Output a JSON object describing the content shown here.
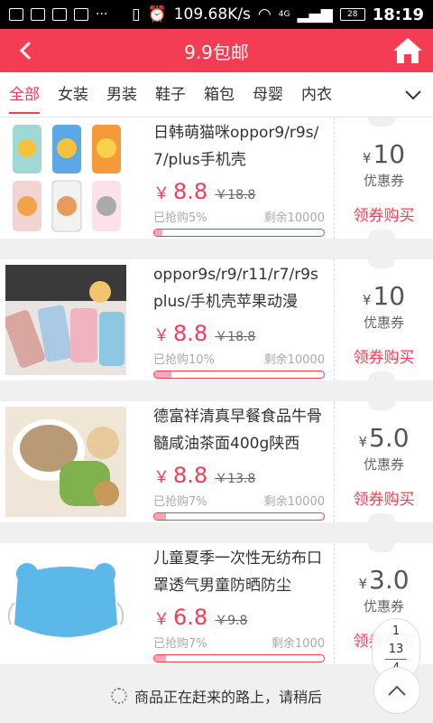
{
  "status_bar": {
    "network_speed": "109.68K/s",
    "signal": "4G",
    "battery": "28",
    "time": "18:19"
  },
  "header": {
    "title": "9.9包邮",
    "back_icon": "chevron-left-icon",
    "home_icon": "home-icon"
  },
  "tabs": [
    {
      "label": "全部",
      "active": true
    },
    {
      "label": "女装",
      "active": false
    },
    {
      "label": "男装",
      "active": false
    },
    {
      "label": "鞋子",
      "active": false
    },
    {
      "label": "箱包",
      "active": false
    },
    {
      "label": "母婴",
      "active": false
    },
    {
      "label": "内衣",
      "active": false
    }
  ],
  "items": [
    {
      "name": "日韩萌猫咪oppor9/r9s/7/plus手机壳",
      "price": "8.8",
      "old_price": "18.8",
      "sold": "已抢购5%",
      "progress": 0.05,
      "remaining": "剩余10000",
      "coupon_amount": "10",
      "coupon_label": "优惠券",
      "buy_label": "领券购买"
    },
    {
      "name": "oppor9s/r9/r11/r7/r9s plus/手机壳苹果动漫",
      "price": "8.8",
      "old_price": "18.8",
      "sold": "已抢购10%",
      "progress": 0.1,
      "remaining": "剩余10000",
      "coupon_amount": "10",
      "coupon_label": "优惠券",
      "buy_label": "领券购买"
    },
    {
      "name": "德富祥清真早餐食品牛骨髓咸油茶面400g陕西",
      "price": "8.8",
      "old_price": "13.8",
      "sold": "已抢购7%",
      "progress": 0.07,
      "remaining": "剩余10000",
      "coupon_amount": "5.0",
      "coupon_label": "优惠券",
      "buy_label": "领券购买"
    },
    {
      "name": "儿童夏季一次性无纺布口罩透气男童防晒防尘",
      "price": "6.8",
      "old_price": "9.8",
      "sold": "已抢购7%",
      "progress": 0.07,
      "remaining": "剩余1000",
      "coupon_amount": "3.0",
      "coupon_label": "优惠券",
      "buy_label": "领券购买"
    }
  ],
  "currency": "￥",
  "coupon_currency": "¥",
  "pager": {
    "current": "1",
    "page": "13",
    "total": "4"
  },
  "footer": {
    "loading_text": "商品正在赶来的路上，请稍后"
  },
  "colors": {
    "accent": "#f43c55"
  }
}
